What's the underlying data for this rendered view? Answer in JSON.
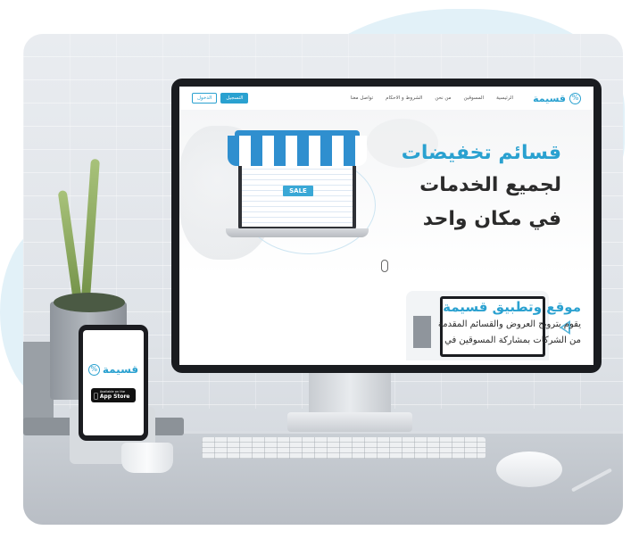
{
  "site": {
    "brand_name": "قسيمة",
    "brand_symbol": "%",
    "accent_color": "#2aa1d0"
  },
  "nav": {
    "items": [
      {
        "label": "الرئيسية"
      },
      {
        "label": "المسوقين"
      },
      {
        "label": "من نحن"
      },
      {
        "label": "الشروط و الاحكام"
      },
      {
        "label": "تواصل معنا"
      }
    ],
    "register_label": "التسجيل",
    "login_label": "الدخول"
  },
  "hero": {
    "line1": "قسائم تخفيضات",
    "line2": "لجميع الخدمات",
    "line3": "في مكان واحد",
    "sale_sign": "SALE"
  },
  "section2": {
    "title": "موقع وتطبيق قسيمة",
    "body_line1": "يقوم بترويج العروض والقسائم المقدمة",
    "body_line2": "من الشركات بمشاركة المسوقين في"
  },
  "phone": {
    "brand_name": "قسيمة",
    "store_small": "Available on the",
    "store_big": "App Store",
    "store_icon": "apple-icon"
  }
}
